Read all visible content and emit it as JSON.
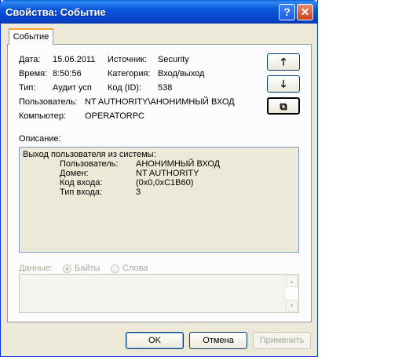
{
  "window": {
    "title": "Свойства: Событие"
  },
  "tab": {
    "label": "Событие"
  },
  "fields": {
    "date_label": "Дата:",
    "date_value": "15.06.2011",
    "source_label": "Источник:",
    "source_value": "Security",
    "time_label": "Время:",
    "time_value": "8:50:56",
    "category_label": "Категория:",
    "category_value": "Вход/выход",
    "type_label": "Тип:",
    "type_value": "Аудит усп",
    "code_label": "Код (ID):",
    "code_value": "538",
    "user_label": "Пользователь:",
    "user_value": "NT AUTHORITY\\АНОНИМНЫЙ ВХОД",
    "computer_label": "Компьютер:",
    "computer_value": "OPERATORPC"
  },
  "nav": {
    "up": "🡑",
    "down": "🡓",
    "copy": "⧉"
  },
  "description": {
    "label": "Описание:",
    "heading": "Выход пользователя из системы:",
    "rows": [
      {
        "key": "Пользователь:",
        "value": "АНОНИМНЫЙ ВХОД"
      },
      {
        "key": "Домен:",
        "value": "NT AUTHORITY"
      },
      {
        "key": "Код входа:",
        "value": "(0x0,0xC1B60)"
      },
      {
        "key": "Тип входа:",
        "value": "3"
      }
    ]
  },
  "data_section": {
    "label": "Данные:",
    "option_bytes": "Байты",
    "option_words": "Слова",
    "selected": "Байты"
  },
  "buttons": {
    "ok": "OK",
    "cancel": "Отмена",
    "apply": "Применить"
  }
}
